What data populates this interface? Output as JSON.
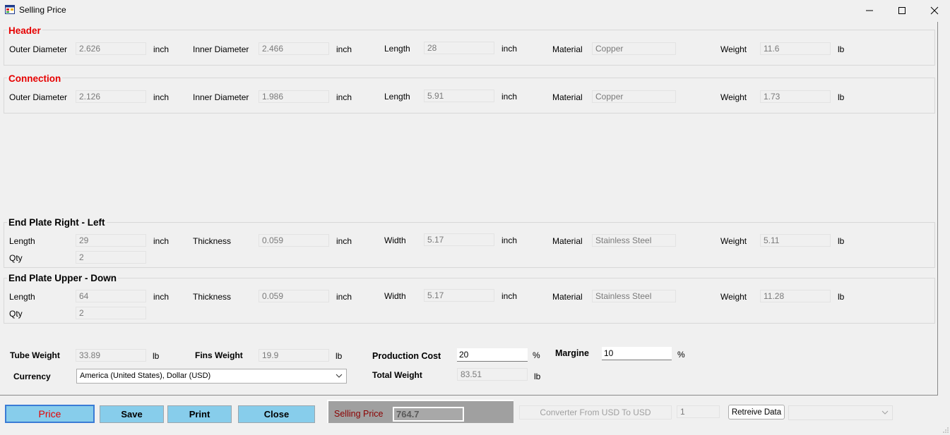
{
  "window": {
    "title": "Selling Price",
    "icons": {
      "app": "app-form-icon",
      "minimize": "minimize-icon",
      "maximize": "maximize-icon",
      "close": "close-icon"
    }
  },
  "header": {
    "title": "Header",
    "outer_diameter_label": "Outer Diameter",
    "outer_diameter": "2.626",
    "outer_unit": "inch",
    "inner_diameter_label": "Inner Diameter",
    "inner_diameter": "2.466",
    "inner_unit": "inch",
    "length_label": "Length",
    "length": "28",
    "length_unit": "inch",
    "material_label": "Material",
    "material": "Copper",
    "weight_label": "Weight",
    "weight": "11.6",
    "weight_unit": "lb"
  },
  "connection": {
    "title": "Connection",
    "outer_diameter_label": "Outer Diameter",
    "outer_diameter": "2.126",
    "outer_unit": "inch",
    "inner_diameter_label": "Inner Diameter",
    "inner_diameter": "1.986",
    "inner_unit": "inch",
    "length_label": "Length",
    "length": "5.91",
    "length_unit": "inch",
    "material_label": "Material",
    "material": "Copper",
    "weight_label": "Weight",
    "weight": "1.73",
    "weight_unit": "lb"
  },
  "end_plate_rl": {
    "title": "End Plate  Right - Left",
    "length_label": "Length",
    "length": "29",
    "length_unit": "inch",
    "thickness_label": "Thickness",
    "thickness": "0.059",
    "thickness_unit": "inch",
    "width_label": "Width",
    "width": "5.17",
    "width_unit": "inch",
    "material_label": "Material",
    "material": "Stainless Steel",
    "weight_label": "Weight",
    "weight": "5.11",
    "weight_unit": "lb",
    "qty_label": "Qty",
    "qty": "2"
  },
  "end_plate_ud": {
    "title": "End Plate  Upper - Down",
    "length_label": "Length",
    "length": "64",
    "length_unit": "inch",
    "thickness_label": "Thickness",
    "thickness": "0.059",
    "thickness_unit": "inch",
    "width_label": "Width",
    "width": "5.17",
    "width_unit": "inch",
    "material_label": "Material",
    "material": "Stainless Steel",
    "weight_label": "Weight",
    "weight": "11.28",
    "weight_unit": "lb",
    "qty_label": "Qty",
    "qty": "2"
  },
  "summary": {
    "tube_weight_label": "Tube Weight",
    "tube_weight": "33.89",
    "tube_weight_unit": "lb",
    "fins_weight_label": "Fins Weight",
    "fins_weight": "19.9",
    "fins_weight_unit": "lb",
    "production_cost_label": "Production Cost",
    "production_cost": "20",
    "production_cost_unit": "%",
    "margine_label": "Margine",
    "margine": "10",
    "margine_unit": "%",
    "currency_label": "Currency",
    "currency": "America (United States), Dollar (USD)",
    "total_weight_label": "Total Weight",
    "total_weight": "83.51",
    "total_weight_unit": "lb"
  },
  "buttons": {
    "price": "Price",
    "save": "Save",
    "print": "Print",
    "close": "Close",
    "retrieve": "Retreive Data"
  },
  "selling_price": {
    "label": "Selling Price",
    "value": "764.7"
  },
  "converter": {
    "label": "Converter From USD To USD",
    "rate": "1",
    "selected": ""
  },
  "colors": {
    "title_red": "#e60000",
    "button_blue": "#87cdeb",
    "selling_label": "#8b0000",
    "panel_gray": "#a0a0a0"
  }
}
